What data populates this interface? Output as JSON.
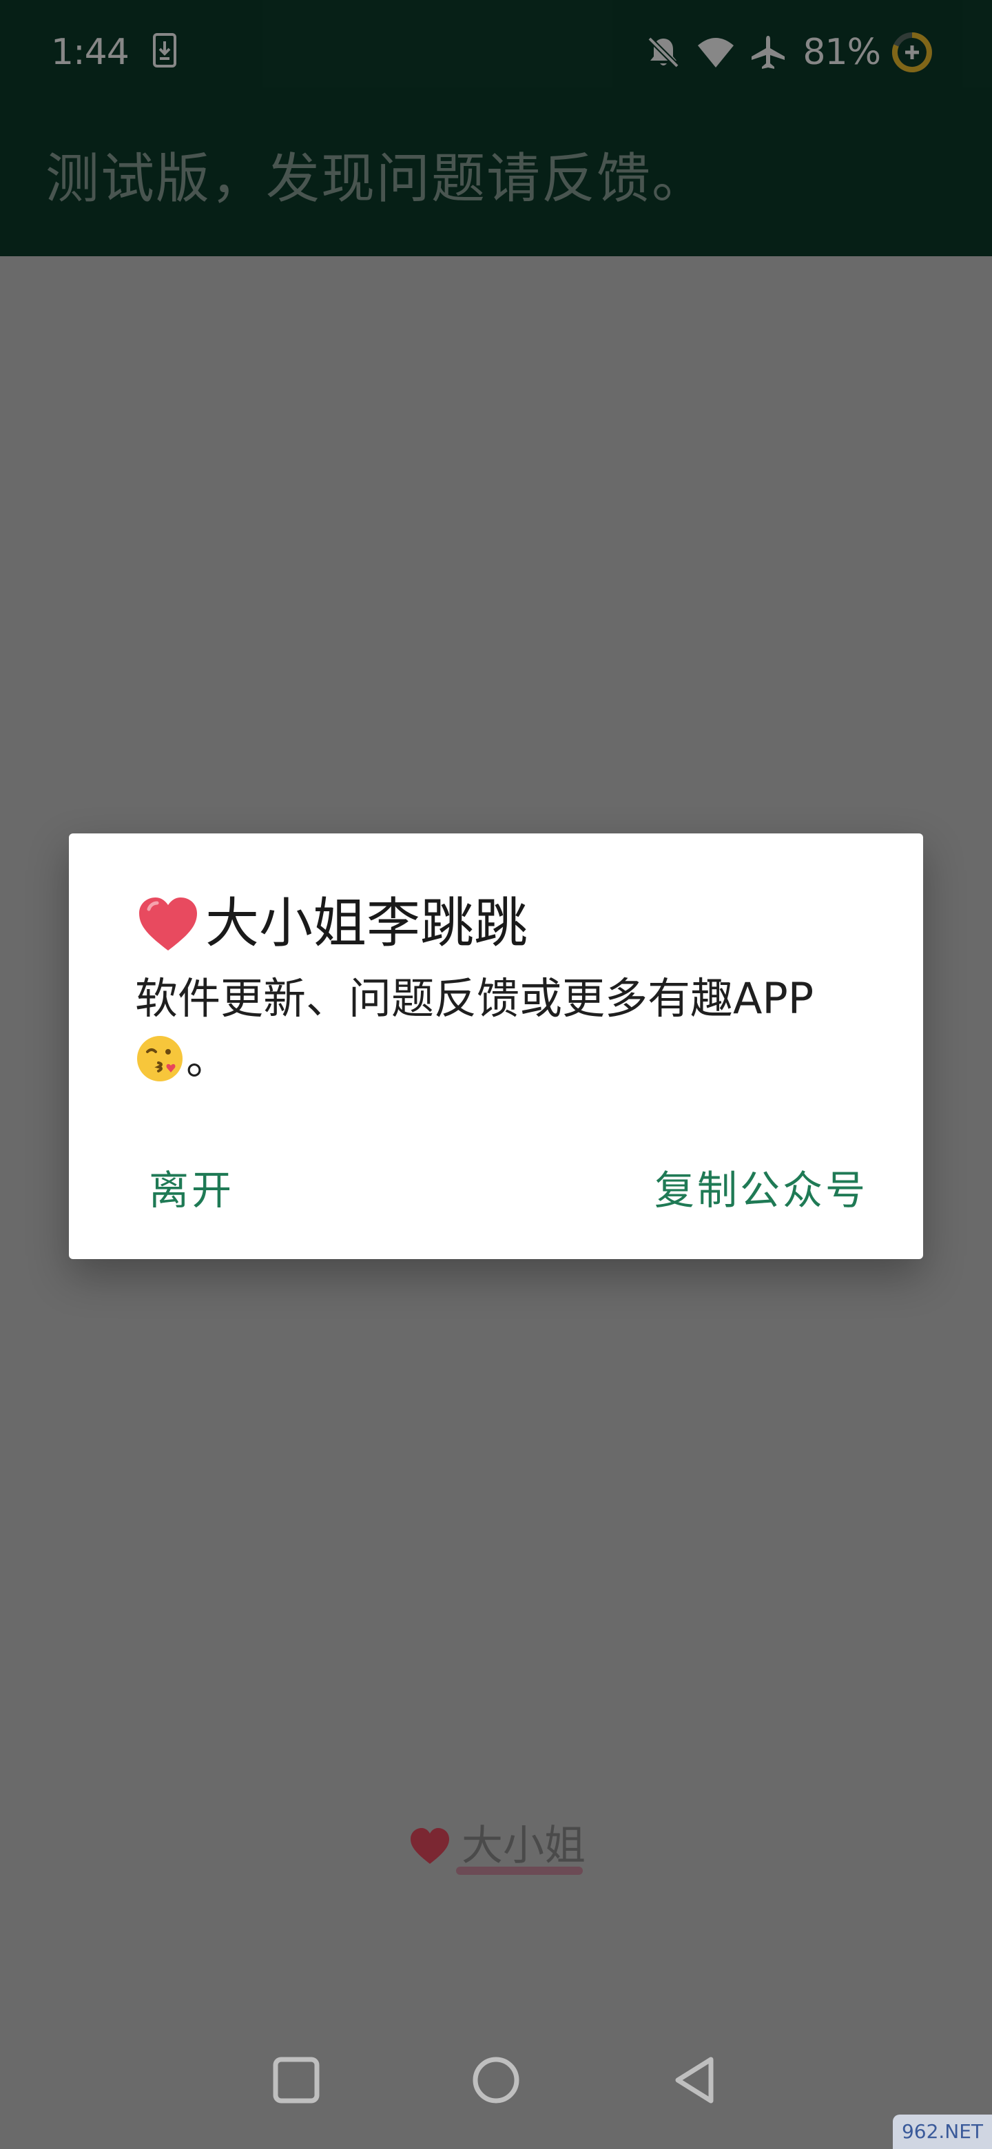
{
  "status_bar": {
    "time": "1:44",
    "battery": "81%",
    "icons": [
      "download-icon",
      "bell-off-icon",
      "wifi-icon",
      "airplane-icon",
      "battery-saver-icon"
    ]
  },
  "app_bar": {
    "title": "测试版，发现问题请反馈。"
  },
  "dialog": {
    "title": "大小姐李跳跳",
    "message": "软件更新、问题反馈或更多有趣APP",
    "message_tail": "。",
    "leave_button": "离开",
    "copy_button": "复制公众号"
  },
  "bottom": {
    "link_text": "大小姐"
  },
  "nav": {
    "icons": [
      "recents-icon",
      "home-icon",
      "back-icon"
    ]
  },
  "watermark": "962.NET",
  "colors": {
    "primary_dark": "#0d3c2b",
    "accent": "#1f7a55",
    "heart": "#e84a5f"
  }
}
